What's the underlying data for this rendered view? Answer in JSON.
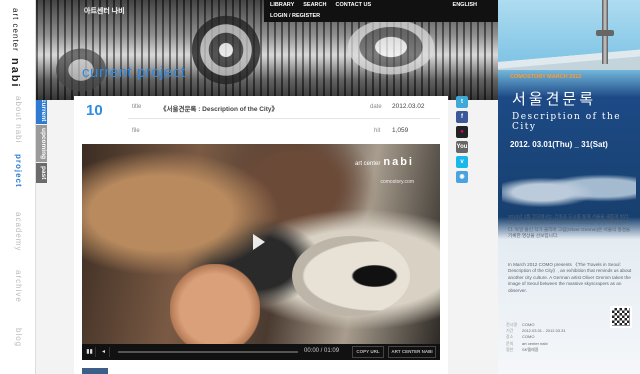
{
  "sidebar": {
    "brand_line1": "art center",
    "brand_line2": "nabi",
    "menu": [
      "current",
      "about nabi",
      "project",
      "academy",
      "archive",
      "blog"
    ],
    "submenu": [
      "current",
      "upcoming",
      "past"
    ]
  },
  "header": {
    "site_logo": "아트센터 나비",
    "nav": [
      "LIBRARY",
      "SEARCH",
      "CONTACT US",
      "LOGIN / REGISTER"
    ],
    "lang": "ENGLISH",
    "page_title": "current project"
  },
  "post": {
    "number": "10",
    "title_label": "title",
    "title": "《서울견문록 : Description of the City》",
    "date_label": "date",
    "date": "2012.03.02",
    "file_label": "file",
    "hit_label": "hit",
    "hits": "1,059"
  },
  "video": {
    "watermark_line1": "art center",
    "watermark_line2": "nabi",
    "watermark_line3": "comostory.com",
    "time": "00:00 / 01:09",
    "copy_url": "COPY URL",
    "channel": "ART CENTER NABI"
  },
  "social": [
    "twitter",
    "facebook",
    "flickr",
    "youtube",
    "vimeo",
    "rss"
  ],
  "poster": {
    "subtitle": "COMOSTORY MARCH 2012",
    "title_ko": "서울견문록",
    "title_en": "Description of the City",
    "date": "2012. 03.01(Thu) _ 31(Sat)",
    "text_ko": "2012년 3월 코모에서는 건축과 도시를 통해 서울을 새롭게 바라보는 《서울견문록 : Description of the City》를 준비하였습니다. 독일 출신 작가 올리버 그림(Oliver Gremm)은 서울의 풍경을 기록한 영상을 선보입니다.",
    "text_en": "In March 2012 COMO presents 《The Travels in Seoul: Description of the City》, an exhibition that reminds us about another city culture. A German artist Oliver Gremm takes the image of Seoul between the massive skyscrapers as an observer.",
    "info": [
      {
        "k": "전시명",
        "v": "COMO"
      },
      {
        "k": "기간",
        "v": "2012.03.01 - 2012.03.31"
      },
      {
        "k": "장소",
        "v": "COMO"
      },
      {
        "k": "문의",
        "v": "art center nabi"
      },
      {
        "k": "협찬",
        "v": "SK텔레콤"
      }
    ]
  }
}
